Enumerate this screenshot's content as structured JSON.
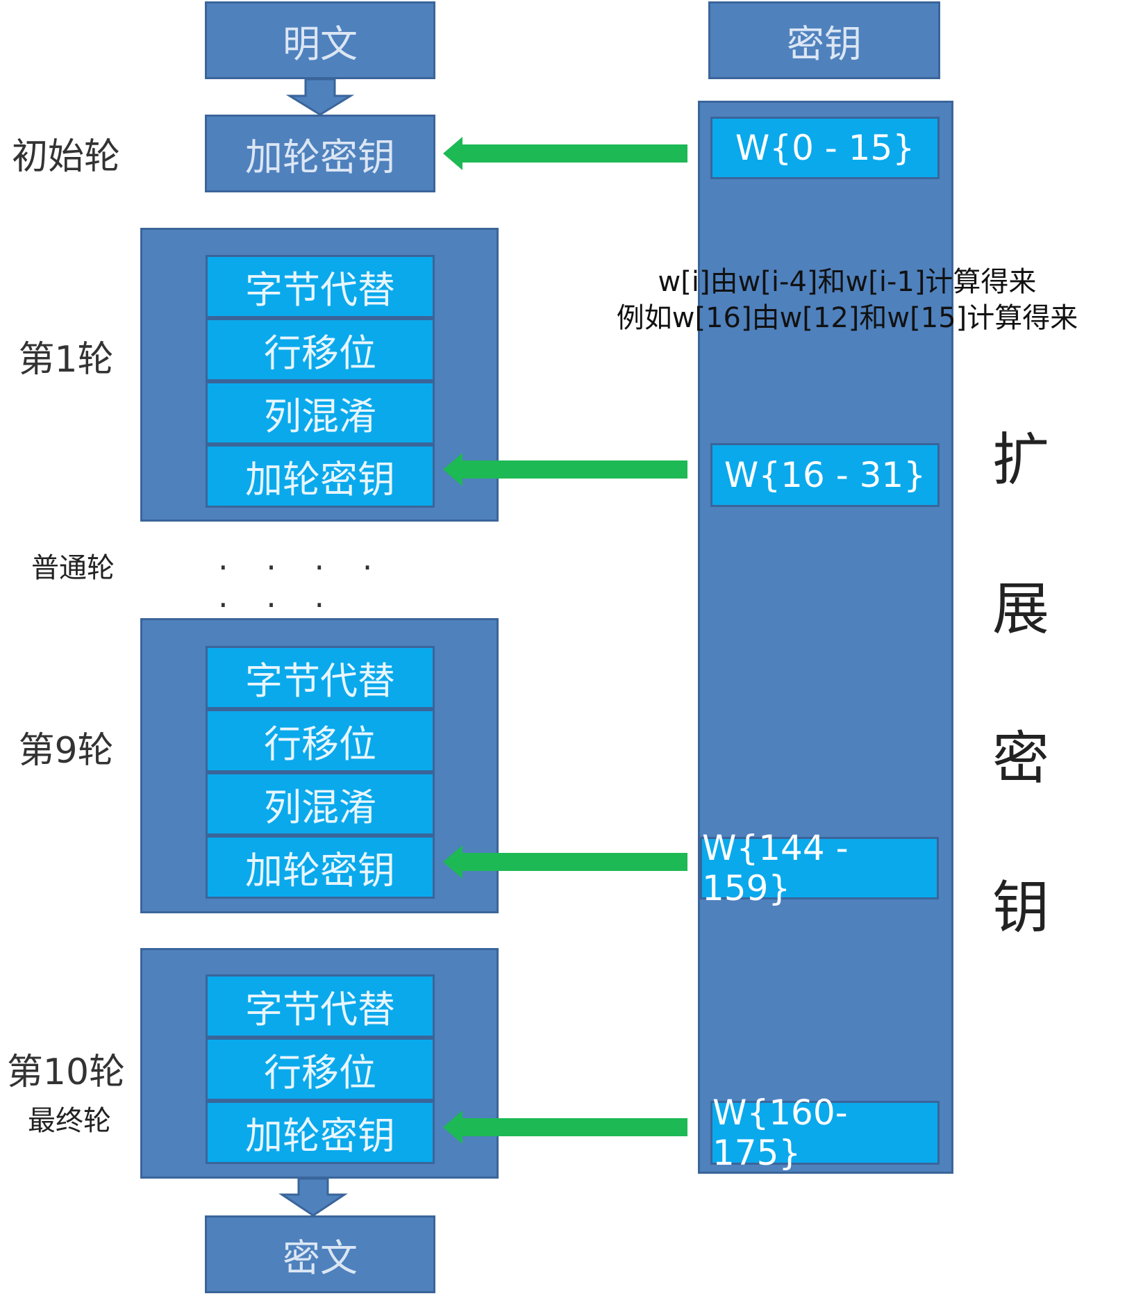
{
  "plaintext": "明文",
  "key": "密钥",
  "ciphertext": "密文",
  "add_round_key": "加轮密钥",
  "sub_bytes": "字节代替",
  "shift_rows": "行移位",
  "mix_columns": "列混淆",
  "labels": {
    "initial_round": "初始轮",
    "round_1": "第1轮",
    "normal_round": "普通轮",
    "ellipsis": "· · · · · · ·",
    "round_9": "第9轮",
    "round_10": "第10轮",
    "final_round": "最终轮"
  },
  "words": {
    "w0": "W{0 - 15}",
    "w1": "W{16 - 31}",
    "w9": "W{144 - 159}",
    "w10": "W{160- 175}"
  },
  "note": {
    "line1": "w[i]由w[i-4]和w[i-1]计算得来",
    "line2": "例如w[16]由w[12]和w[15]计算得来"
  },
  "expanded_key": [
    "扩",
    "展",
    "密",
    "钥"
  ],
  "colors": {
    "dark_blue": "#4f81bd",
    "light_blue": "#0aa9ec",
    "arrow_green": "#1db954"
  }
}
